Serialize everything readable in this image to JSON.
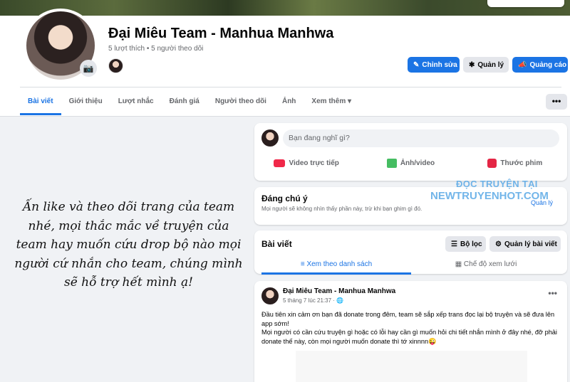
{
  "header": {
    "page_name": "Đại Miêu Team - Manhua Manhwa",
    "stats": "5 lượt thích • 5 người theo dõi",
    "buttons": {
      "edit": "Chỉnh sửa",
      "manage": "Quản lý",
      "ads": "Quảng cáo"
    },
    "tabs": [
      "Bài viết",
      "Giới thiệu",
      "Lượt nhắc",
      "Đánh giá",
      "Người theo dõi",
      "Ảnh",
      "Xem thêm"
    ],
    "more_button": "•••"
  },
  "note": {
    "lines": [
      "Ấn like và theo dõi trang của team",
      "nhé, mọi thắc mắc về truyện của",
      "team hay muốn cứu drop bộ nào mọi",
      "người cứ nhắn cho team, chúng mình",
      "sẽ hỗ trợ hết mình ạ!"
    ]
  },
  "composer": {
    "placeholder": "Bạn đang nghĩ gì?",
    "actions": [
      "Video trực tiếp",
      "Ảnh/video",
      "Thước phim"
    ]
  },
  "notice": {
    "title": "Đáng chú ý",
    "text": "Mọi người sẽ không nhìn thấy phần này, trừ khi bạn ghim gì đó.",
    "link": "Quản lý"
  },
  "posts_section": {
    "title": "Bài viết",
    "filter": "Bộ lọc",
    "manage": "Quản lý bài viết",
    "view_tabs": [
      "Xem theo danh sách",
      "Chế độ xem lưới"
    ]
  },
  "post": {
    "author": "Đại Miêu Team - Manhua Manhwa",
    "time": "5 tháng 7 lúc 21:37 · 🌐",
    "menu": "•••",
    "paragraphs": [
      "Đầu tiên xin cảm ơn bạn đã donate trong đêm, team sẽ sắp xếp trans đọc lại bộ truyện và sẽ đưa lên app sớm!",
      "Mọi người có cần cứu truyện gì hoặc có lỗi hay cần gì muốn hỏi chi tiết nhắn mình ở đây nhé, đỡ phải donate thế này, còn mọi người muốn donate thì tớ xinnnn😜"
    ]
  },
  "watermark": {
    "line1": "ĐỌC TRUYỆN TẠI",
    "line2": "NEWTRUYENHOT.COM"
  },
  "colors": {
    "accent": "#1b74e4",
    "background": "#f0f2f5",
    "muted_text": "#65676b"
  },
  "icons": {
    "camera": "camera-icon",
    "edit": "pencil-icon",
    "manage": "tools-icon",
    "ads": "megaphone-icon",
    "dropdown": "caret-down-icon",
    "live": "live-video-icon",
    "photo": "photo-icon",
    "reel": "reel-icon",
    "filter": "filter-icon",
    "gear": "gear-icon",
    "list": "list-icon",
    "grid": "grid-icon",
    "globe": "globe-icon"
  }
}
